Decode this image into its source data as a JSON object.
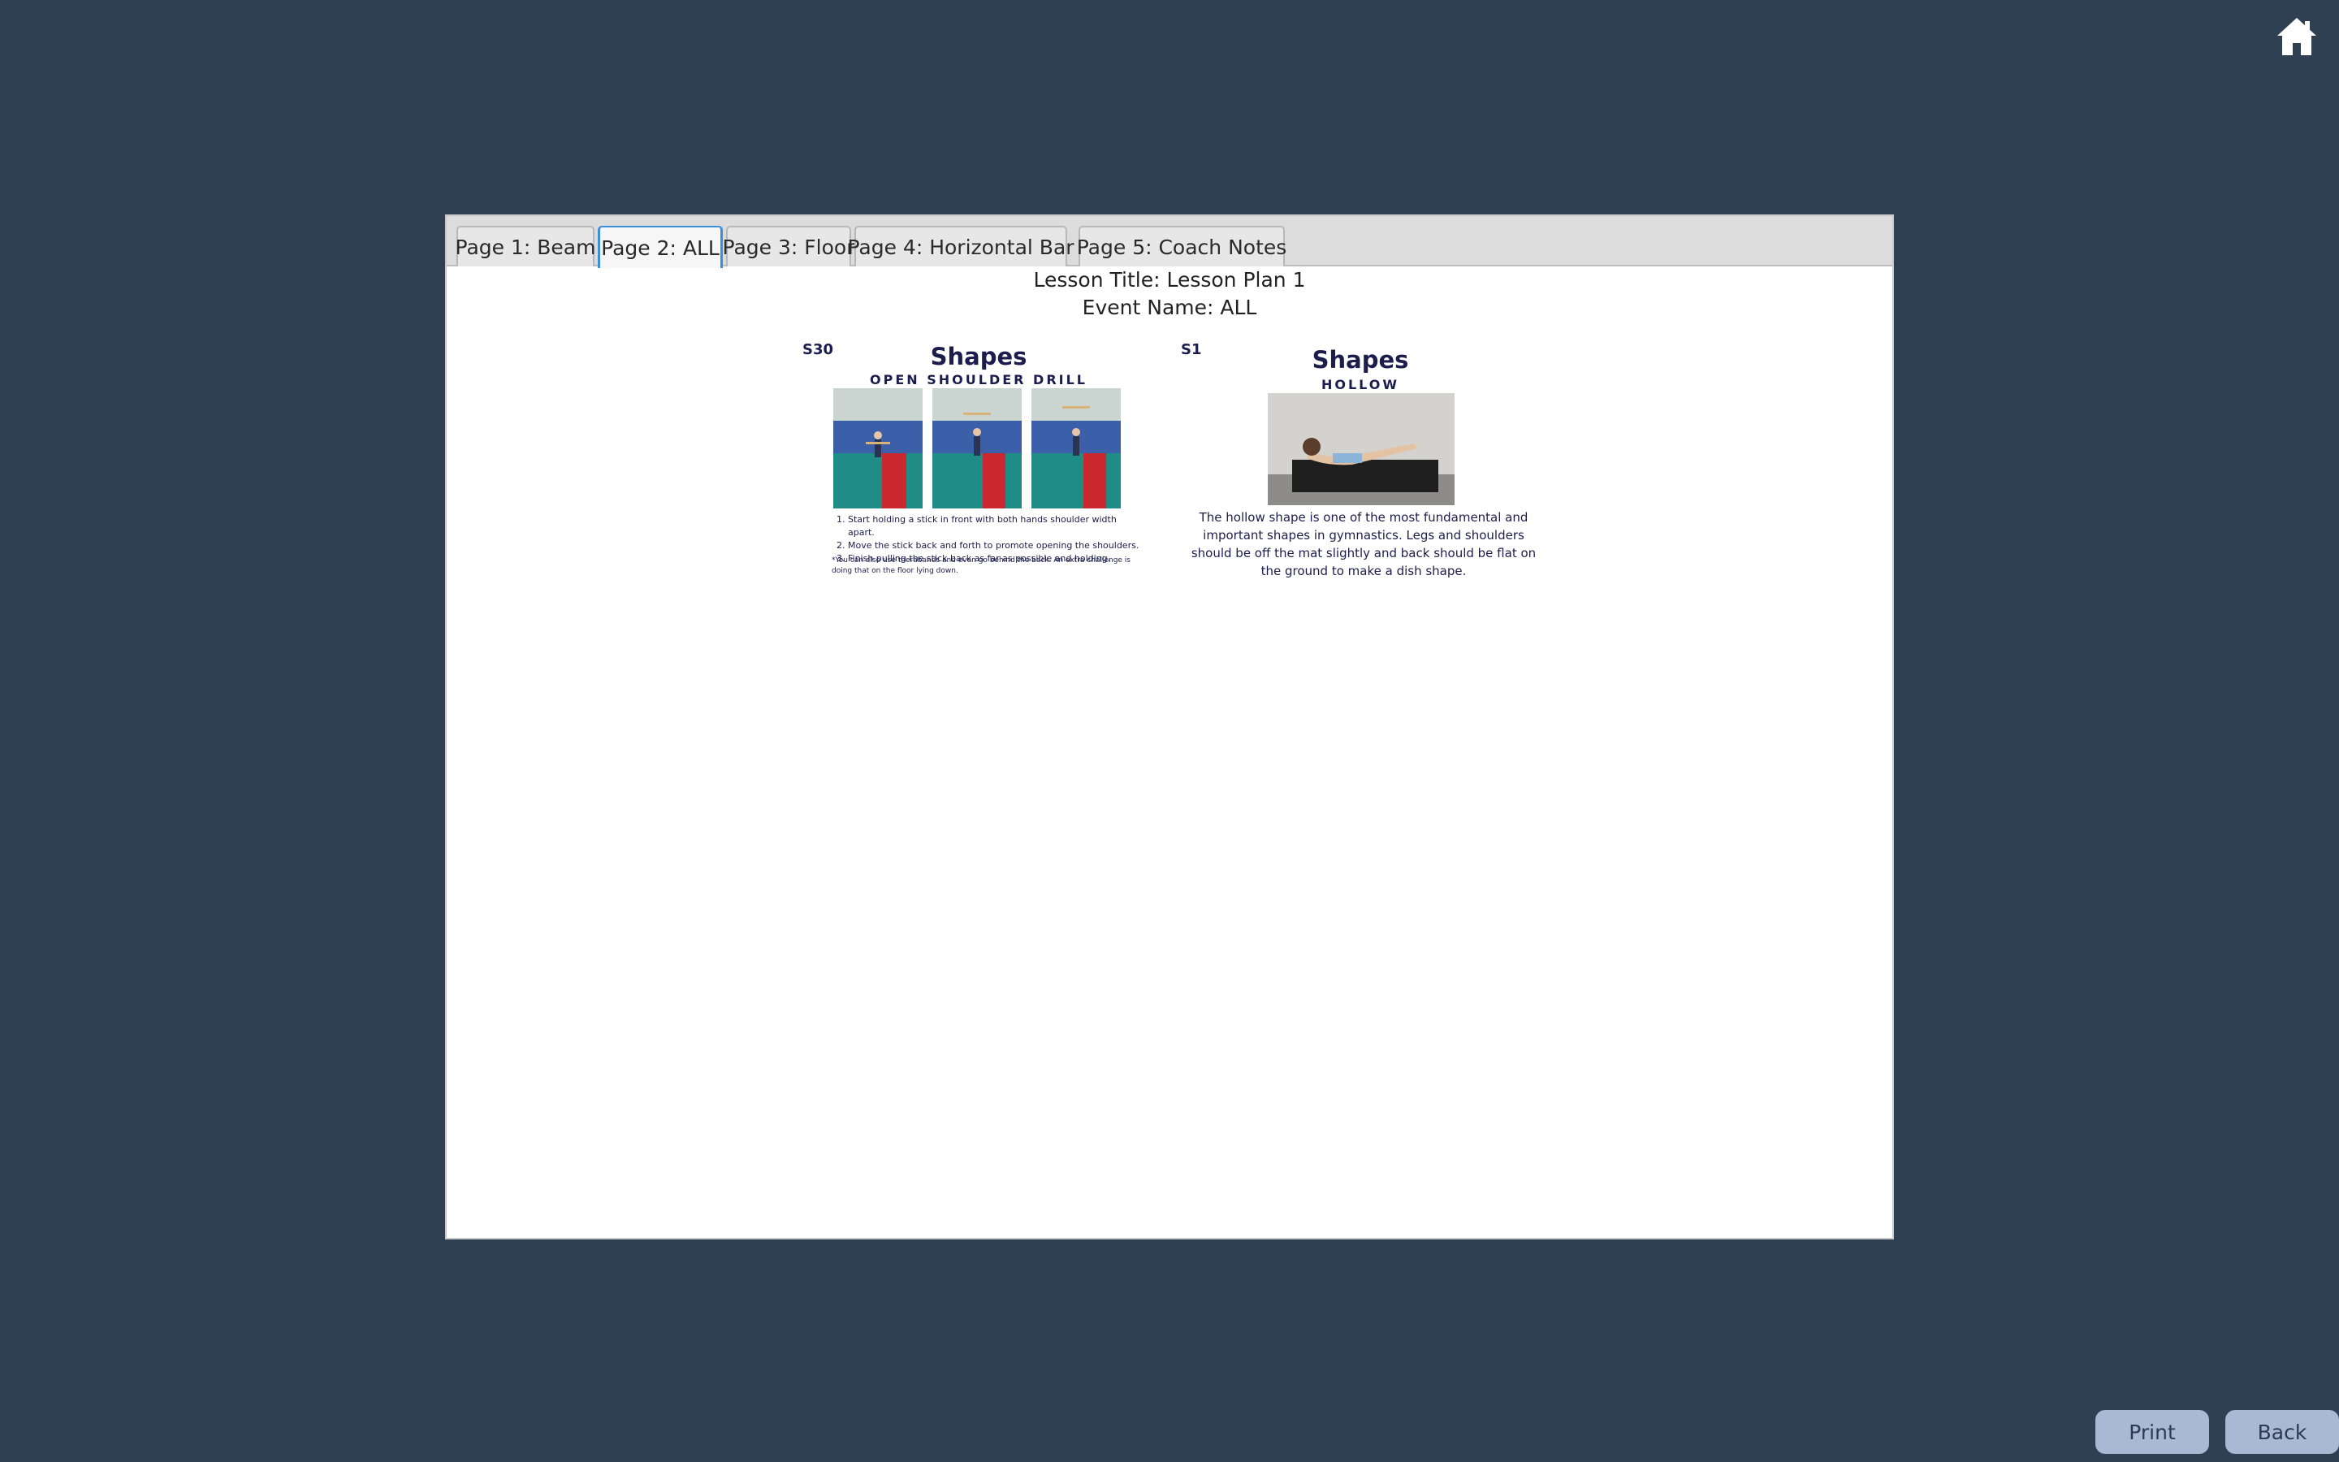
{
  "header": {
    "home_icon": "home-icon"
  },
  "tabs": [
    {
      "label": "Page 1: Beam",
      "active": false
    },
    {
      "label": "Page 2: ALL",
      "active": true
    },
    {
      "label": "Page 3: Floor",
      "active": false
    },
    {
      "label": "Page 4: Horizontal Bar",
      "active": false
    },
    {
      "label": "Page 5: Coach Notes",
      "active": false
    }
  ],
  "lesson": {
    "title_line": "Lesson Title: Lesson Plan 1",
    "event_line": "Event Name: ALL"
  },
  "cards": [
    {
      "code": "S30",
      "title": "Shapes",
      "subtitle": "OPEN SHOULDER DRILL",
      "steps": [
        "Start holding a stick in front with both hands shoulder width apart.",
        "Move the stick back and forth to promote opening the shoulders.",
        "Finish pulling the stick back as far as possible and holding."
      ],
      "note": "*You can also use therabands and even go behind the back. An extra challenge is doing that on the floor lying down."
    },
    {
      "code": "S1",
      "title": "Shapes",
      "subtitle": "HOLLOW",
      "description": "The hollow shape is one of the most fundamental and important shapes in gymnastics. Legs and shoulders should be off the mat slightly and back should be flat on the ground to make a dish shape."
    }
  ],
  "footer": {
    "print_label": "Print",
    "back_label": "Back"
  },
  "colors": {
    "background": "#2f4052",
    "button": "#a9b9d3",
    "active_tab_border": "#3b8fd8",
    "card_text": "#1c1d4d"
  }
}
